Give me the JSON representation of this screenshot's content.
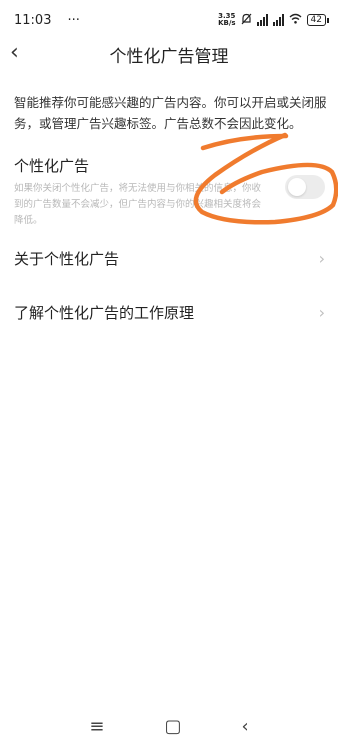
{
  "status_bar": {
    "time": "11:03",
    "dots": "···",
    "net_speed_value": "3.35",
    "net_speed_unit": "KB/s",
    "battery": "42"
  },
  "header": {
    "back_icon": "‹",
    "title": "个性化广告管理"
  },
  "intro_text": "智能推荐你可能感兴趣的广告内容。你可以开启或关闭服务，或管理广告兴趣标签。广告总数不会因此变化。",
  "personalized_ads": {
    "title": "个性化广告",
    "description": "如果你关闭个性化广告，将无法使用与你相关的信息，你收到的广告数量不会减少，但广告内容与你的兴趣相关度将会降低。",
    "toggle_on": false
  },
  "links": [
    {
      "label": "关于个性化广告",
      "chevron": "›"
    },
    {
      "label": "了解个性化广告的工作原理",
      "chevron": "›"
    }
  ],
  "system_nav": {
    "menu": "≡",
    "home": "▢",
    "back": "‹"
  },
  "colors": {
    "scribble": "#f07b2e",
    "toggle_off": "#ececec"
  }
}
